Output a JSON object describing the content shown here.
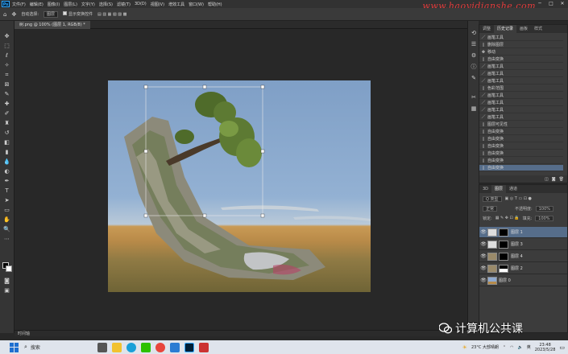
{
  "menu": {
    "app_icon": "Ps",
    "items": [
      "文件(F)",
      "编辑(E)",
      "图像(I)",
      "图层(L)",
      "文字(Y)",
      "选择(S)",
      "滤镜(T)",
      "3D(D)",
      "视图(V)",
      "增效工具",
      "窗口(W)",
      "帮助(H)"
    ],
    "watermark": "www.haoyidianshe.com"
  },
  "options": {
    "auto_select_label": "自动选择:",
    "auto_select_value": "图层",
    "show_transform_label": "显示变换控件"
  },
  "document": {
    "tab_title": "树.png @ 100% (图层 1, RGB/8) *",
    "status_text": "时间轴"
  },
  "history": {
    "tabs": [
      "调整",
      "历史记录",
      "画板",
      "样式"
    ],
    "items": [
      "画笔工具",
      "删除图层",
      "移动",
      "自由变换",
      "画笔工具",
      "画笔工具",
      "画笔工具",
      "色彩范围",
      "画笔工具",
      "画笔工具",
      "画笔工具",
      "画笔工具",
      "图层可见性",
      "自由变换",
      "自由变换",
      "自由变换",
      "自由变换",
      "自由变换",
      "自由变换"
    ]
  },
  "layers": {
    "tabs": [
      "3D",
      "图层",
      "通道"
    ],
    "kind_label": "Q 类型",
    "blend_mode": "正常",
    "opacity_label": "不透明度:",
    "opacity_value": "100%",
    "lock_label": "锁定:",
    "fill_label": "填充:",
    "fill_value": "100%",
    "rows": [
      "图层 1",
      "图层 3",
      "图层 4",
      "图层 2",
      "图层 0"
    ]
  },
  "branding": {
    "wechat_text": "计算机公共课"
  },
  "taskbar": {
    "search_label": "搜索",
    "weather": "23°C 大部晴朗",
    "lang": "英",
    "time": "23:48",
    "date": "2023/5/28"
  },
  "colors": {
    "ps_accent": "#31a8ff",
    "watermark": "#e23b3b",
    "selection": "#566d8a"
  }
}
